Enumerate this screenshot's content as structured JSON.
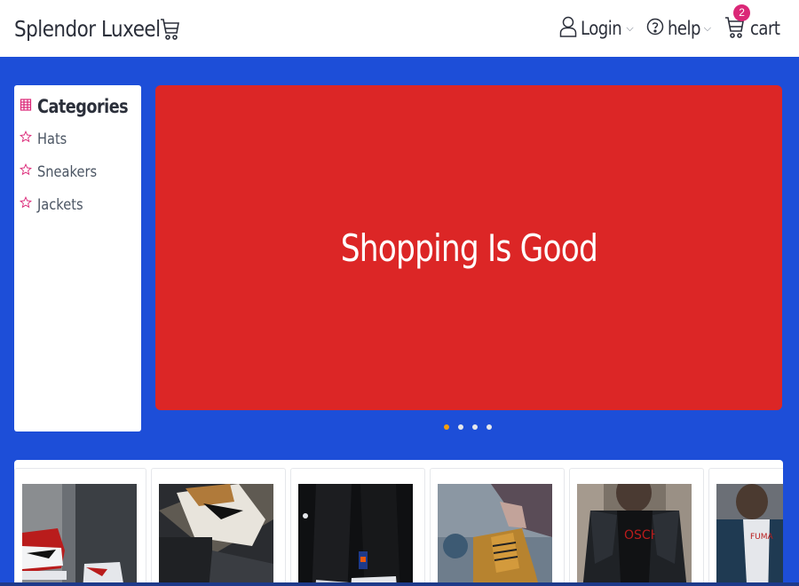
{
  "header": {
    "brand": "Splendor Luxeel",
    "login_label": "Login",
    "help_label": "help",
    "cart_label": "cart",
    "cart_count": "2"
  },
  "categories": {
    "heading": "Categories",
    "items": [
      {
        "label": "Hats",
        "icon": "star-outline-icon"
      },
      {
        "label": "Sneakers",
        "icon": "star-outline-icon"
      },
      {
        "label": "Jackets",
        "icon": "star-outline-icon"
      }
    ]
  },
  "hero": {
    "title": "Shopping Is Good",
    "slide_count": 4,
    "active_slide": 1
  },
  "products": [
    {
      "image": "red-white-sneakers-photo"
    },
    {
      "image": "tan-sneaker-photo"
    },
    {
      "image": "dark-legs-sneakers-photo"
    },
    {
      "image": "tan-boot-lacing-photo"
    },
    {
      "image": "black-jacket-man-photo"
    },
    {
      "image": "denim-jacket-man-photo"
    }
  ],
  "colors": {
    "page_bg": "#1d4ed8",
    "hero_bg": "#dc2626",
    "accent_pink": "#db2777",
    "active_dot": "#f59e0b"
  }
}
